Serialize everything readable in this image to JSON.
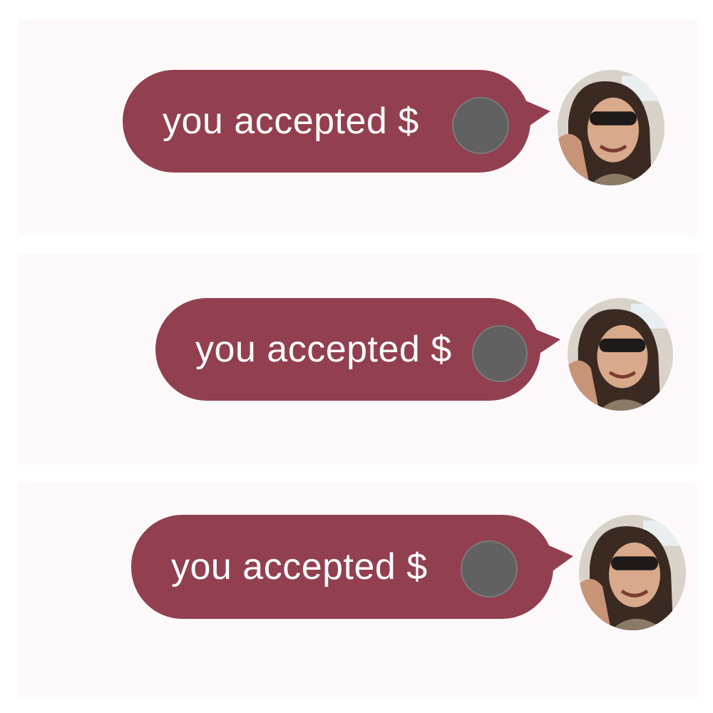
{
  "colors": {
    "bubble": "#92404f",
    "bubble_text": "#ffffff",
    "panel_background": "#fdf9fb",
    "redaction": "#616161"
  },
  "messages": [
    {
      "text": "you accepted $",
      "amount_redacted": true,
      "avatar_icon": "user-photo-avatar"
    },
    {
      "text": "you accepted $",
      "amount_redacted": true,
      "avatar_icon": "user-photo-avatar"
    },
    {
      "text": "you accepted $",
      "amount_redacted": true,
      "avatar_icon": "user-photo-avatar"
    }
  ]
}
